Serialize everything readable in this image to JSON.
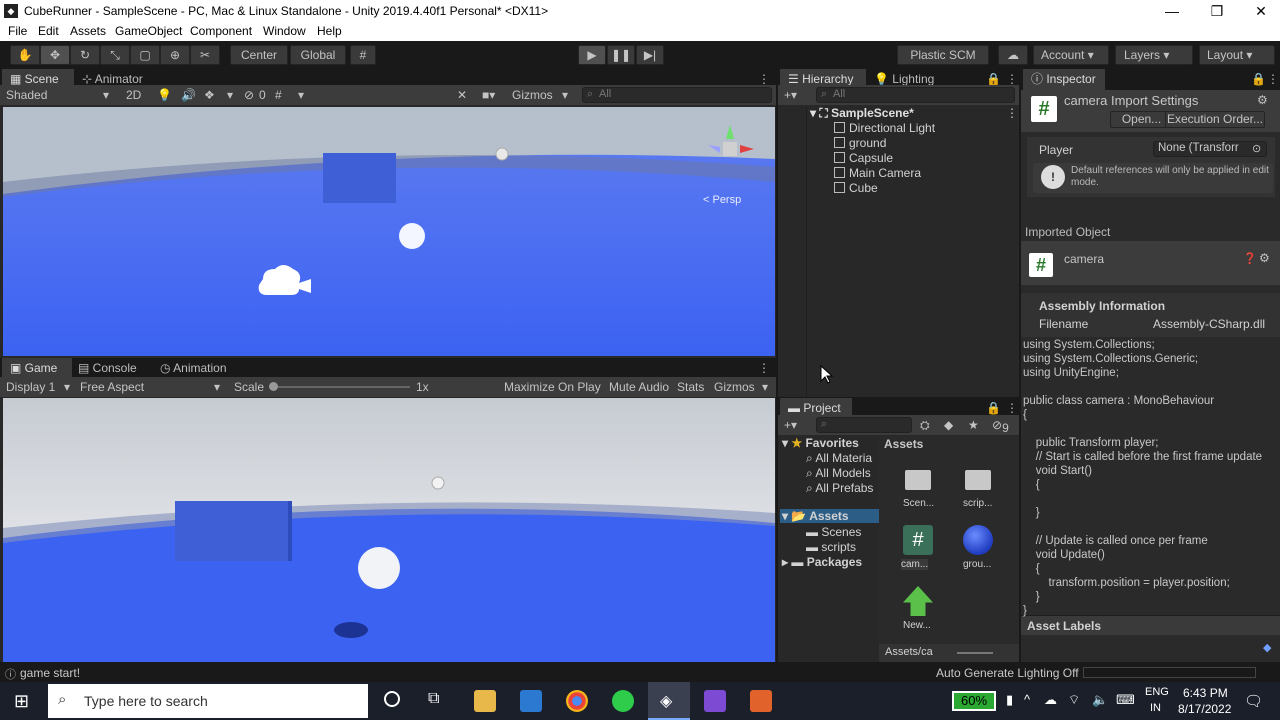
{
  "window": {
    "title": "CubeRunner - SampleScene - PC, Mac & Linux Standalone - Unity 2019.4.40f1 Personal* <DX11>",
    "app_icon": "unity-icon",
    "controls": [
      "—",
      "❐",
      "✕"
    ]
  },
  "menu": [
    "File",
    "Edit",
    "Assets",
    "GameObject",
    "Component",
    "Window",
    "Help"
  ],
  "toolbar": {
    "center": "Center",
    "global": "Global",
    "plastic": "Plastic SCM",
    "account": "Account",
    "layers": "Layers",
    "layout": "Layout"
  },
  "scene": {
    "tab_scene": "Scene",
    "tab_animator": "Animator",
    "shading": "Shaded",
    "mode2d": "2D",
    "hidden_count": "0",
    "gizmos": "Gizmos",
    "search_placeholder": "All",
    "persp": "< Persp"
  },
  "game": {
    "tab_game": "Game",
    "tab_console": "Console",
    "tab_animation": "Animation",
    "display": "Display 1",
    "aspect": "Free Aspect",
    "scale_label": "Scale",
    "scale_value": "1x",
    "maximize": "Maximize On Play",
    "mute": "Mute Audio",
    "stats": "Stats",
    "gizmos": "Gizmos"
  },
  "hierarchy": {
    "tab": "Hierarchy",
    "tab_lighting": "Lighting",
    "search_placeholder": "All",
    "scene": "SampleScene*",
    "items": [
      "Directional Light",
      "ground",
      "Capsule",
      "Main Camera",
      "Cube"
    ]
  },
  "project": {
    "tab": "Project",
    "hidden_count": "9",
    "favorites": "Favorites",
    "fav_items": [
      "All Materia",
      "All Models",
      "All Prefabs"
    ],
    "assets_root": "Assets",
    "folders": [
      "Scenes",
      "scripts"
    ],
    "packages": "Packages",
    "breadcrumb": "Assets",
    "grid": [
      {
        "label": "Scen...",
        "icon": "folder-icon"
      },
      {
        "label": "scrip...",
        "icon": "folder-icon"
      },
      {
        "label": "cam...",
        "icon": "script-icon"
      },
      {
        "label": "grou...",
        "icon": "material-sphere-icon"
      },
      {
        "label": "New...",
        "icon": "animator-icon"
      }
    ],
    "path": "Assets/ca"
  },
  "inspector": {
    "tab": "Inspector",
    "title": "camera Import Settings",
    "open": "Open...",
    "exec_order": "Execution Order...",
    "player_label": "Player",
    "player_value": "None (Transforr",
    "info_text": "Default references will only be applied in edit mode.",
    "imported_object": "Imported Object",
    "object_name": "camera",
    "assembly_info": "Assembly Information",
    "filename_label": "Filename",
    "filename_value": "Assembly-CSharp.dll",
    "asset_labels": "Asset Labels"
  },
  "code": [
    "using System.Collections;",
    "using System.Collections.Generic;",
    "using UnityEngine;",
    "",
    "public class camera : MonoBehaviour",
    "{",
    "",
    "    public Transform player;",
    "    // Start is called before the first frame update",
    "    void Start()",
    "    {",
    "",
    "    }",
    "",
    "    // Update is called once per frame",
    "    void Update()",
    "    {",
    "        transform.position = player.position;",
    "    }",
    "}"
  ],
  "status": {
    "message": "game start!",
    "lighting": "Auto Generate Lighting Off"
  },
  "taskbar": {
    "search_placeholder": "Type here to search",
    "battery": "60%",
    "lang1": "ENG",
    "lang2": "IN",
    "time": "6:43 PM",
    "date": "8/17/2022"
  },
  "colors": {
    "sky_top": "#b7c6d9",
    "ground": "#3c62f2",
    "panel": "#282828",
    "accent_blue": "#3e5fd6"
  }
}
